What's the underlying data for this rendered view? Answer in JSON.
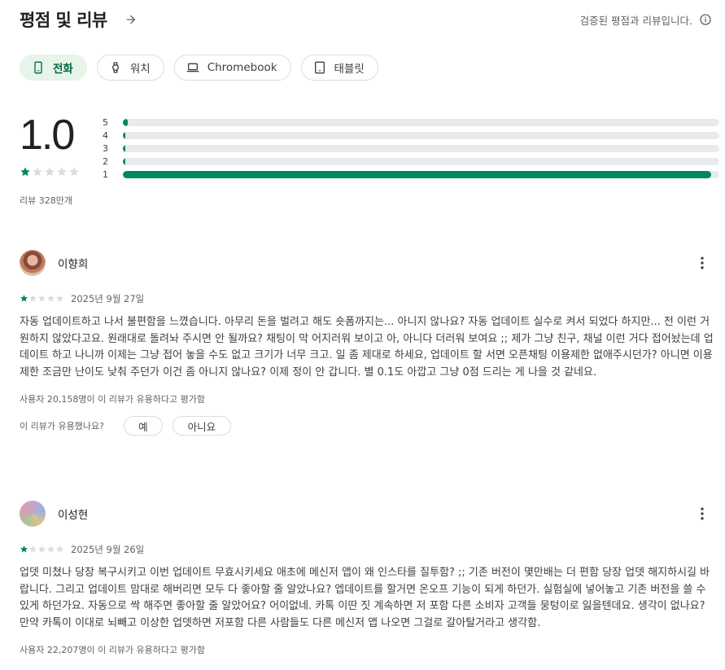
{
  "header": {
    "title": "평점 및 리뷰",
    "verified_text": "검증된 평점과 리뷰입니다.",
    "arrow_icon": "arrow-right-icon",
    "info_icon": "info-icon"
  },
  "device_tabs": [
    {
      "label": "전화",
      "icon": "phone-icon",
      "selected": true
    },
    {
      "label": "워치",
      "icon": "watch-icon",
      "selected": false
    },
    {
      "label": "Chromebook",
      "icon": "laptop-icon",
      "selected": false
    },
    {
      "label": "태블릿",
      "icon": "tablet-icon",
      "selected": false
    }
  ],
  "rating_summary": {
    "score": "1.0",
    "stars_filled": 1,
    "stars_total": 5,
    "review_count": "리뷰 328만개",
    "accent_color": "#01875f",
    "distribution": [
      {
        "label": "5",
        "fraction": 0.008
      },
      {
        "label": "4",
        "fraction": 0.002
      },
      {
        "label": "3",
        "fraction": 0.002
      },
      {
        "label": "2",
        "fraction": 0.002
      },
      {
        "label": "1",
        "fraction": 0.986
      }
    ]
  },
  "reviews": [
    {
      "name": "이향희",
      "rating": 1,
      "date": "2025년 9월 27일",
      "text": "자동 업데이트하고 나서 불편함을 느꼈습니다. 아무리 돈을 벌려고 해도 숏폼까지는... 아니지 않나요? 자동 업데이트 실수로 켜서 되었다 하지만... 전 이런 거 원하지 않았다고요. 원래대로 돌려놔 주시면 안 될까요? 채팅이 막 어지러워 보이고 아, 아니다 더러워 보여요 ;; 제가 그냥 친구, 채널 이런 거다 접어놨는데 업데이트 하고 나니까 이제는 그냥 접어 놓을 수도 없고 크기가 너무 크고. 일 좀 제대로 하세요, 업데이트 할 서면 오픈채팅 이용제한 없애주시던가? 아니면 이용제한 조금만 난이도 낮춰 주던가 이건 좀 아니지 않나요? 이제 정이 안 갑니다. 별 0.1도 아깝고 그냥 0점 드리는 게 나을 것 같네요.",
      "helpful": "사용자 20,158명이 이 리뷰가 유용하다고 평가함",
      "helpful_question": "이 리뷰가 유용했나요?",
      "yes_label": "예",
      "no_label": "아니요"
    },
    {
      "name": "이성현",
      "rating": 1,
      "date": "2025년 9월 26일",
      "text": "업뎃 미쳤나 당장 복구시키고 이번 업데이트 무효시키세요 애초에 메신저 앱이 왜 인스타를 질투함? ;; 기존 버전이 몇만배는 더 편함 당장 업뎃 해지하시길 바랍니다. 그리고 업데이트 맘대로 해버리면 모두 다 좋아할 줄 알았나요? 엡데이트를 할거면 온오프 기능이 되게 하던가. 실험실에 넣어놓고 기존 버전을 쓸 수 있게 하던가요. 자동으로 싹 해주면 좋아할 줄 알았어요? 어이없네. 카톡 이딴 짓 계속하면 저 포함 다른 소비자 고객들 뭉텅이로 잃을텐데요. 생각이 없나요? 만약 카톡이 이대로 뇌빼고 이상한 업뎃하면 저포함 다른 사람들도 다른 메신저 앱 나오면 그걸로 갈아탈거라고 생각함.",
      "helpful": "사용자 22,207명이 이 리뷰가 유용하다고 평가함"
    }
  ]
}
